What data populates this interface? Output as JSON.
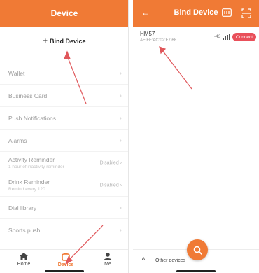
{
  "left": {
    "header_title": "Device",
    "bind_plus": "+",
    "bind_label": "Bind Device",
    "menu": [
      {
        "label": "Wallet"
      },
      {
        "label": "Business Card"
      },
      {
        "label": "Push Notifications"
      },
      {
        "label": "Alarms"
      },
      {
        "label": "Activity Reminder",
        "sub": "1 hour of inactivity reminder",
        "state": "Disabled"
      },
      {
        "label": "Drink Reminder",
        "sub": "Remind every 120",
        "state": "Disabled"
      },
      {
        "label": "Dial library"
      },
      {
        "label": "Sports push"
      }
    ],
    "tabs": {
      "home": "Home",
      "device": "Device",
      "me": "Me"
    }
  },
  "right": {
    "header_title": "Bind Device",
    "device": {
      "name": "HM57",
      "mac": "AF:FF:AC:02:F7:68",
      "rssi": "-43",
      "connect_label": "Connect"
    },
    "other_devices_label": "Other devices"
  },
  "colors": {
    "accent": "#f07a35",
    "connect": "#e9505a",
    "annotation_arrow": "#e0575b"
  }
}
